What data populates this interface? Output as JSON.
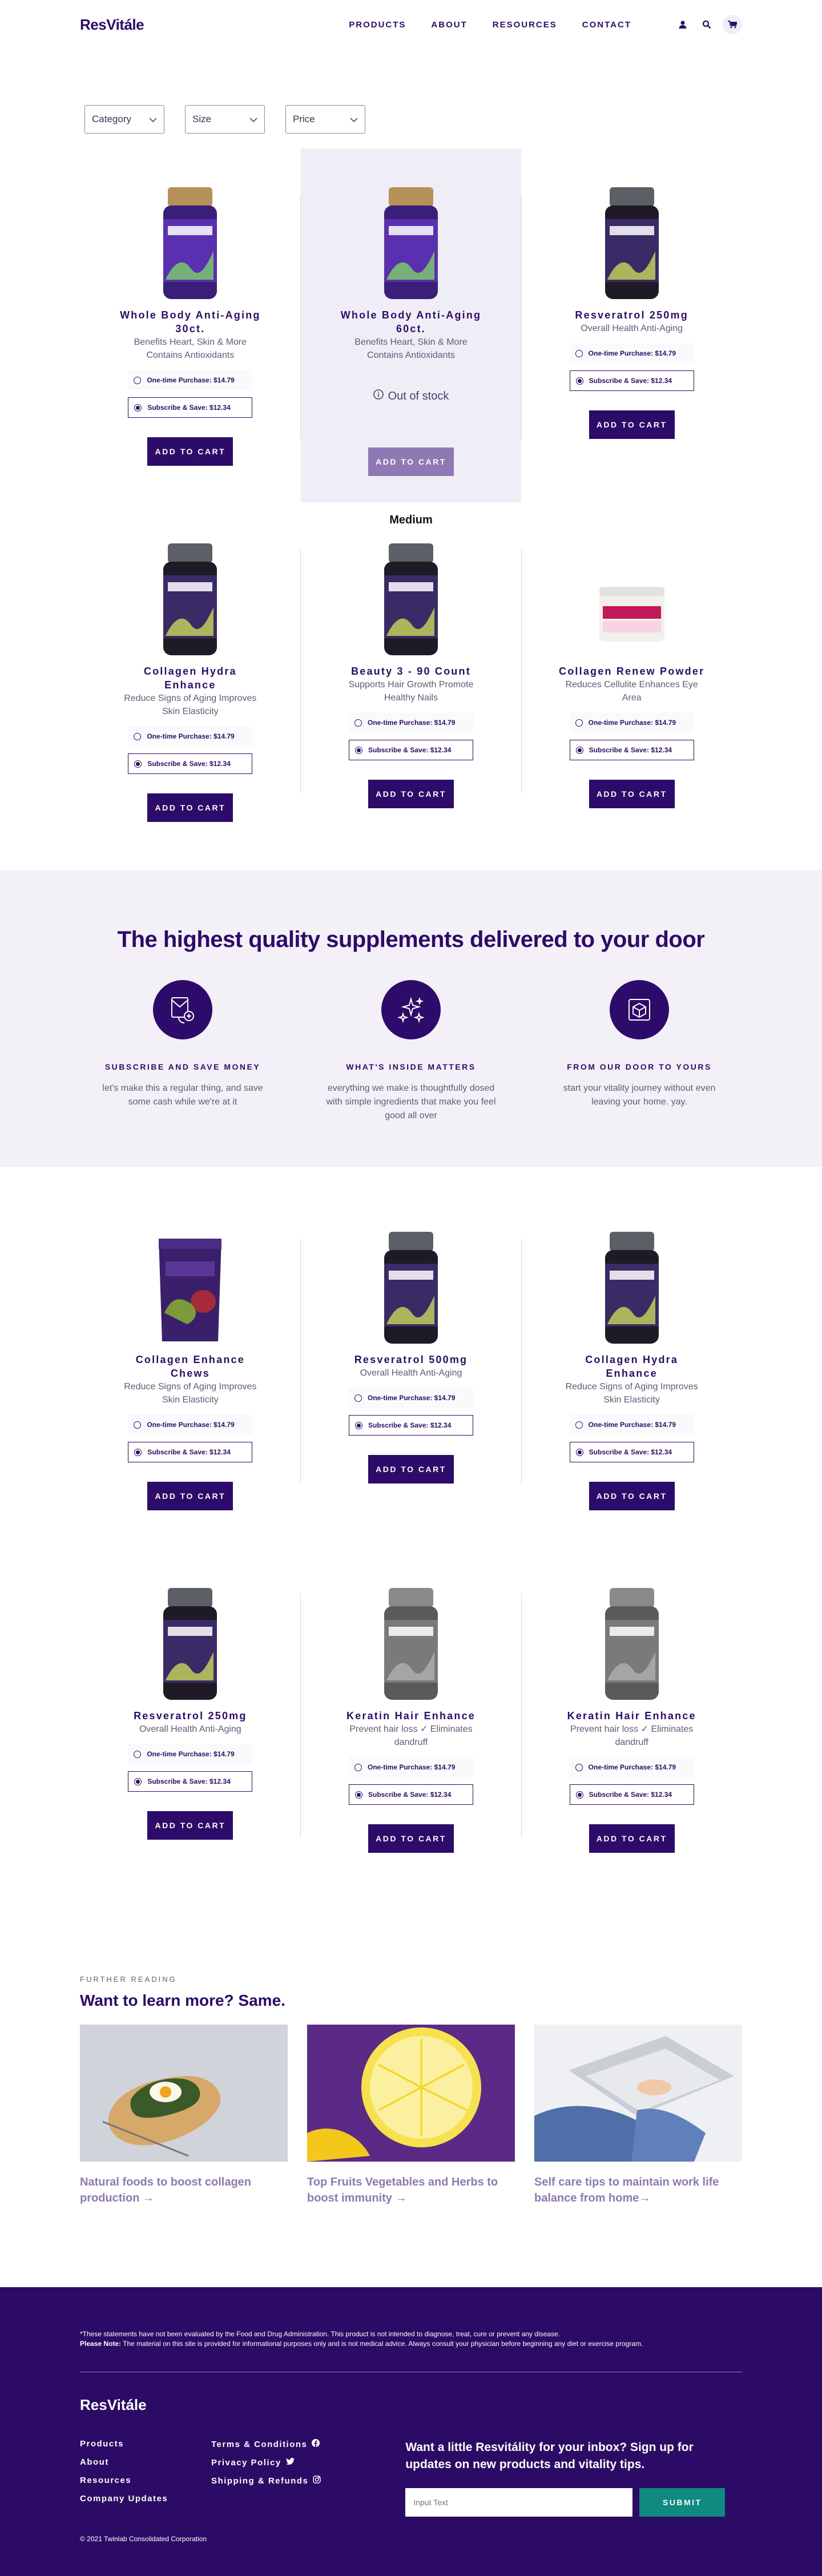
{
  "header": {
    "logo": "ResVitále",
    "nav": [
      "PRODUCTS",
      "ABOUT",
      "RESOURCES",
      "CONTACT"
    ]
  },
  "filters": [
    "Category",
    "Size",
    "Price"
  ],
  "medium_label": "Medium",
  "products_top": [
    {
      "name": "Whole Body Anti-Aging 30ct.",
      "desc": "Benefits Heart, Skin & More Contains Antioxidants",
      "style": "purple",
      "once": "One-time Purchase: $14.79",
      "sub": "Subscribe & Save: $12.34",
      "cta": "ADD TO CART"
    },
    {
      "name": "Whole Body Anti-Aging 60ct.",
      "desc": "Benefits Heart, Skin & More Contains Antioxidants",
      "style": "purple",
      "oos": "Out of stock",
      "cta": "ADD TO CART"
    },
    {
      "name": "Resveratrol 250mg",
      "desc": "Overall Health Anti-Aging",
      "style": "dark",
      "once": "One-time Purchase: $14.79",
      "sub": "Subscribe & Save: $12.34",
      "cta": "ADD TO CART"
    },
    {
      "name": "Collagen Hydra Enhance",
      "desc": "Reduce Signs of Aging Improves Skin Elasticity",
      "style": "dark",
      "once": "One-time Purchase: $14.79",
      "sub": "Subscribe & Save: $12.34",
      "cta": "ADD TO CART"
    },
    {
      "name": "Beauty 3 - 90 Count",
      "desc": "Supports Hair Growth Promote Healthy Nails",
      "style": "dark",
      "once": "One-time Purchase: $14.79",
      "sub": "Subscribe & Save: $12.34",
      "cta": "ADD TO CART"
    },
    {
      "name": "Collagen Renew Powder",
      "desc": "Reduces Cellulite Enhances Eye Area",
      "style": "tub",
      "once": "One-time Purchase: $14.79",
      "sub": "Subscribe & Save: $12.34",
      "cta": "ADD TO CART"
    }
  ],
  "band": {
    "title": "The highest quality supplements delivered to your door",
    "features": [
      {
        "title": "SUBSCRIBE AND SAVE MONEY",
        "text": "let's make this a regular thing, and save some cash while we're at it",
        "icon": "subscribe-icon"
      },
      {
        "title": "WHAT'S INSIDE MATTERS",
        "text": "everything we make is thoughtfully dosed with simple ingredients that make you feel good all over",
        "icon": "sparkle-icon"
      },
      {
        "title": "FROM OUR DOOR TO YOURS",
        "text": "start your vitality journey without even leaving your home. yay.",
        "icon": "box-icon"
      }
    ]
  },
  "products_bottom": [
    {
      "name": "Collagen Enhance Chews",
      "desc": "Reduce Signs of Aging Improves Skin Elasticity",
      "style": "pouch",
      "once": "One-time Purchase: $14.79",
      "sub": "Subscribe & Save: $12.34",
      "cta": "ADD TO CART"
    },
    {
      "name": "Resveratrol 500mg",
      "desc": "Overall Health Anti-Aging",
      "style": "dark",
      "once": "One-time Purchase: $14.79",
      "sub": "Subscribe & Save: $12.34",
      "cta": "ADD TO CART"
    },
    {
      "name": "Collagen Hydra Enhance",
      "desc": "Reduce Signs of Aging Improves Skin Elasticity",
      "style": "dark",
      "once": "One-time Purchase: $14.79",
      "sub": "Subscribe & Save: $12.34",
      "cta": "ADD TO CART"
    },
    {
      "name": "Resveratrol 250mg",
      "desc": "Overall Health Anti-Aging",
      "style": "dark",
      "once": "One-time Purchase: $14.79",
      "sub": "Subscribe & Save: $12.34",
      "cta": "ADD TO CART"
    },
    {
      "name": "Keratin Hair Enhance",
      "desc": "Prevent hair loss ✓ Eliminates dandruff",
      "style": "gray",
      "once": "One-time Purchase: $14.79",
      "sub": "Subscribe & Save: $12.34",
      "cta": "ADD TO CART"
    },
    {
      "name": "Keratin Hair Enhance",
      "desc": "Prevent hair loss ✓ Eliminates dandruff",
      "style": "gray",
      "once": "One-time Purchase: $14.79",
      "sub": "Subscribe & Save: $12.34",
      "cta": "ADD TO CART"
    }
  ],
  "reading": {
    "eyebrow": "FURTHER READING",
    "title": "Want to learn more? Same.",
    "articles": [
      {
        "title": "Natural foods to boost collagen production →",
        "img": "toast"
      },
      {
        "title": "Top Fruits Vegetables and Herbs to boost immunity →",
        "img": "lemon"
      },
      {
        "title": "Self care tips to maintain work life balance from home→",
        "img": "laptop"
      }
    ]
  },
  "footer": {
    "disclaimer": "*These statements have not been evaluated by the Food and Drug Administration. This product is not intended to diagnose, treat, cure or prevent any disease.",
    "note_label": "Please Note:",
    "note": " The material on this site is provided for informational purposes only and is not medical advice. Always consult your physician before beginning any diet or exercise program.",
    "logo": "ResVitále",
    "col1": [
      "Products",
      "About",
      "Resources",
      "Company Updates"
    ],
    "col2": [
      "Terms & Conditions",
      "Privacy Policy",
      "Shipping & Refunds"
    ],
    "newsletter": "Want a little Resvitálity for your inbox? Sign up for updates on new products and vitality tips.",
    "input_placeholder": "Input Text",
    "submit": "SUBMIT",
    "copyright": "© 2021 Twinlab Consolidated Corporation"
  },
  "colors": {
    "brand": "#2d0b6b",
    "footer": "#2b0b66",
    "submit": "#0f8a80",
    "band": "#f3f1f7"
  }
}
